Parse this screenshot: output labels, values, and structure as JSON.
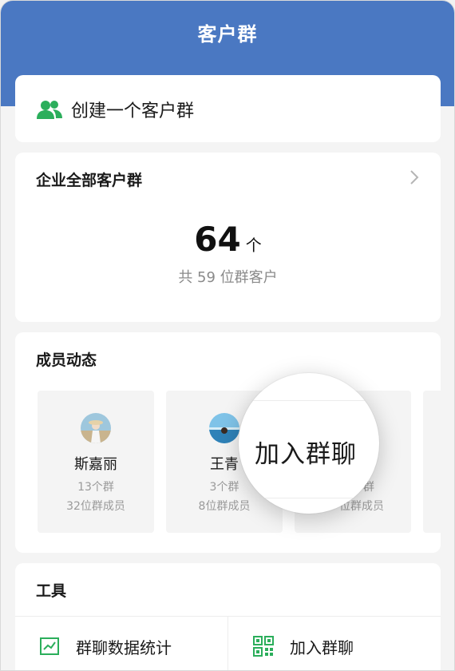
{
  "header": {
    "title": "客户群"
  },
  "create": {
    "label": "创建一个客户群"
  },
  "all_groups": {
    "title": "企业全部客户群",
    "count": "64",
    "unit": "个",
    "subtitle": "共 59 位群客户"
  },
  "members": {
    "title": "成员动态",
    "items": [
      {
        "name": "斯嘉丽",
        "groups": "13个群",
        "member_count": "32位群成员"
      },
      {
        "name": "王青",
        "groups": "3个群",
        "member_count": "8位群成员"
      },
      {
        "name": "",
        "groups": "群",
        "member_count": "位群成员"
      }
    ]
  },
  "magnifier": {
    "text": "加入群聊"
  },
  "tools": {
    "title": "工具",
    "items": [
      {
        "label": "群聊数据统计",
        "icon": "chart-icon"
      },
      {
        "label": "加入群聊",
        "icon": "qr-code-icon"
      }
    ]
  },
  "colors": {
    "header": "#4a78c2",
    "accent_green": "#2bae5b"
  }
}
